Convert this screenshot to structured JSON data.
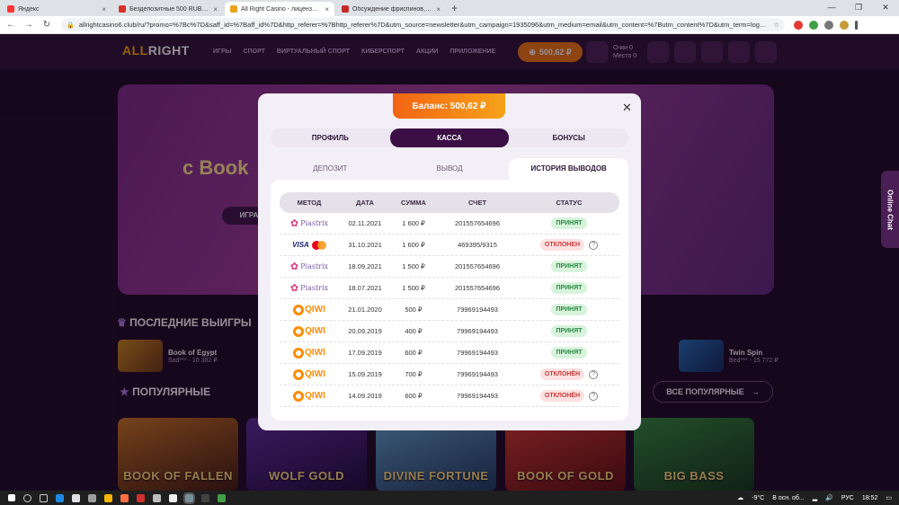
{
  "browser": {
    "tabs": [
      {
        "title": "Яндекс",
        "color": "#ff3333",
        "active": false
      },
      {
        "title": "Бездепозитные 500 RUB для",
        "color": "#d93025",
        "active": false
      },
      {
        "title": "All Right Casino - лицензионны",
        "color": "#e8a21a",
        "active": true
      },
      {
        "title": "Обсуждение фриспинов, акций",
        "color": "#c62828",
        "active": false
      }
    ],
    "url": "allrightcasino6.club/ru/?promo=%7Bc%7D&saff_id=%7Baff_id%7D&http_referer=%7Bhttp_referer%7D&utm_source=newsletter&utm_campaign=1935096&utm_medium=email&utm_content=%7Butm_content%7D&utm_term=logo&cli..."
  },
  "site": {
    "logo_a": "ALL",
    "logo_b": "RIGHT",
    "nav": [
      "ИГРЫ",
      "СПОРТ",
      "ВИРТУАЛЬНЫЙ СПОРТ",
      "КИБЕРСПОРТ",
      "АКЦИИ",
      "ПРИЛОЖЕНИЕ"
    ],
    "header_balance": "500,62 ₽",
    "points_line1": "Очки 0",
    "points_line2": "Место 0",
    "banner_title": "с Book",
    "banner_button": "ИГРАТЬ",
    "last_wins_title": "ПОСЛЕДНИЕ ВЫИГРЫ",
    "wins": [
      {
        "game": "Book of Egypt",
        "amount": "Sad*** - 10 382 ₽"
      },
      {
        "game": "Twin Spin",
        "amount": "Bed*** - 15 772 ₽"
      }
    ],
    "popular_title": "ПОПУЛЯРНЫЕ",
    "all_popular": "ВСЕ ПОПУЛЯРНЫЕ",
    "games": [
      "BOOK OF FALLEN",
      "WOLF GOLD",
      "DIVINE FORTUNE",
      "BOOK OF GOLD",
      "BIG BASS"
    ],
    "online_chat": "Online Chat"
  },
  "modal": {
    "balance": "Баланс: 500,62 ₽",
    "tabs": [
      "ПРОФИЛЬ",
      "КАССА",
      "БОНУСЫ"
    ],
    "active_tab": "КАССА",
    "subtabs": [
      "ДЕПОЗИТ",
      "ВЫВОД",
      "ИСТОРИЯ ВЫВОДОВ"
    ],
    "active_subtab": "ИСТОРИЯ ВЫВОДОВ",
    "columns": [
      "МЕТОД",
      "ДАТА",
      "СУММА",
      "СЧЕТ",
      "СТАТУС"
    ],
    "rows": [
      {
        "method": "piastrix",
        "date": "02.11.2021",
        "amount": "1 600 ₽",
        "account": "201557654696",
        "status": "ПРИНЯТ",
        "ok": true
      },
      {
        "method": "visa",
        "date": "31.10.2021",
        "amount": "1 600 ₽",
        "account": "469395/9315",
        "status": "ОТКЛОНЕН",
        "ok": false
      },
      {
        "method": "piastrix",
        "date": "18.09.2021",
        "amount": "1 500 ₽",
        "account": "201557654696",
        "status": "ПРИНЯТ",
        "ok": true
      },
      {
        "method": "piastrix",
        "date": "18.07.2021",
        "amount": "1 500 ₽",
        "account": "201557654696",
        "status": "ПРИНЯТ",
        "ok": true
      },
      {
        "method": "qiwi",
        "date": "21.01.2020",
        "amount": "500 ₽",
        "account": "79969194493",
        "status": "ПРИНЯТ",
        "ok": true
      },
      {
        "method": "qiwi",
        "date": "20.09.2019",
        "amount": "400 ₽",
        "account": "79969194493",
        "status": "ПРИНЯТ",
        "ok": true
      },
      {
        "method": "qiwi",
        "date": "17.09.2019",
        "amount": "600 ₽",
        "account": "79969194493",
        "status": "ПРИНЯТ",
        "ok": true
      },
      {
        "method": "qiwi",
        "date": "15.09.2019",
        "amount": "700 ₽",
        "account": "79969194493",
        "status": "ОТКЛОНЁН",
        "ok": false
      },
      {
        "method": "qiwi",
        "date": "14.09.2019",
        "amount": "600 ₽",
        "account": "79969194493",
        "status": "ОТКЛОНЁН",
        "ok": false
      }
    ],
    "method_labels": {
      "piastrix": "Piastrix",
      "visa": "VISA",
      "qiwi": "QIWI"
    }
  },
  "taskbar": {
    "weather": "-9°C",
    "weather_note": "В осн. об...",
    "lang": "РУС",
    "time": "18:52"
  },
  "colors": {
    "accent_orange": "#f26413",
    "primary_dark": "#3b0f45",
    "ok_green": "#2a8a44",
    "reject_red": "#c93b3b"
  }
}
